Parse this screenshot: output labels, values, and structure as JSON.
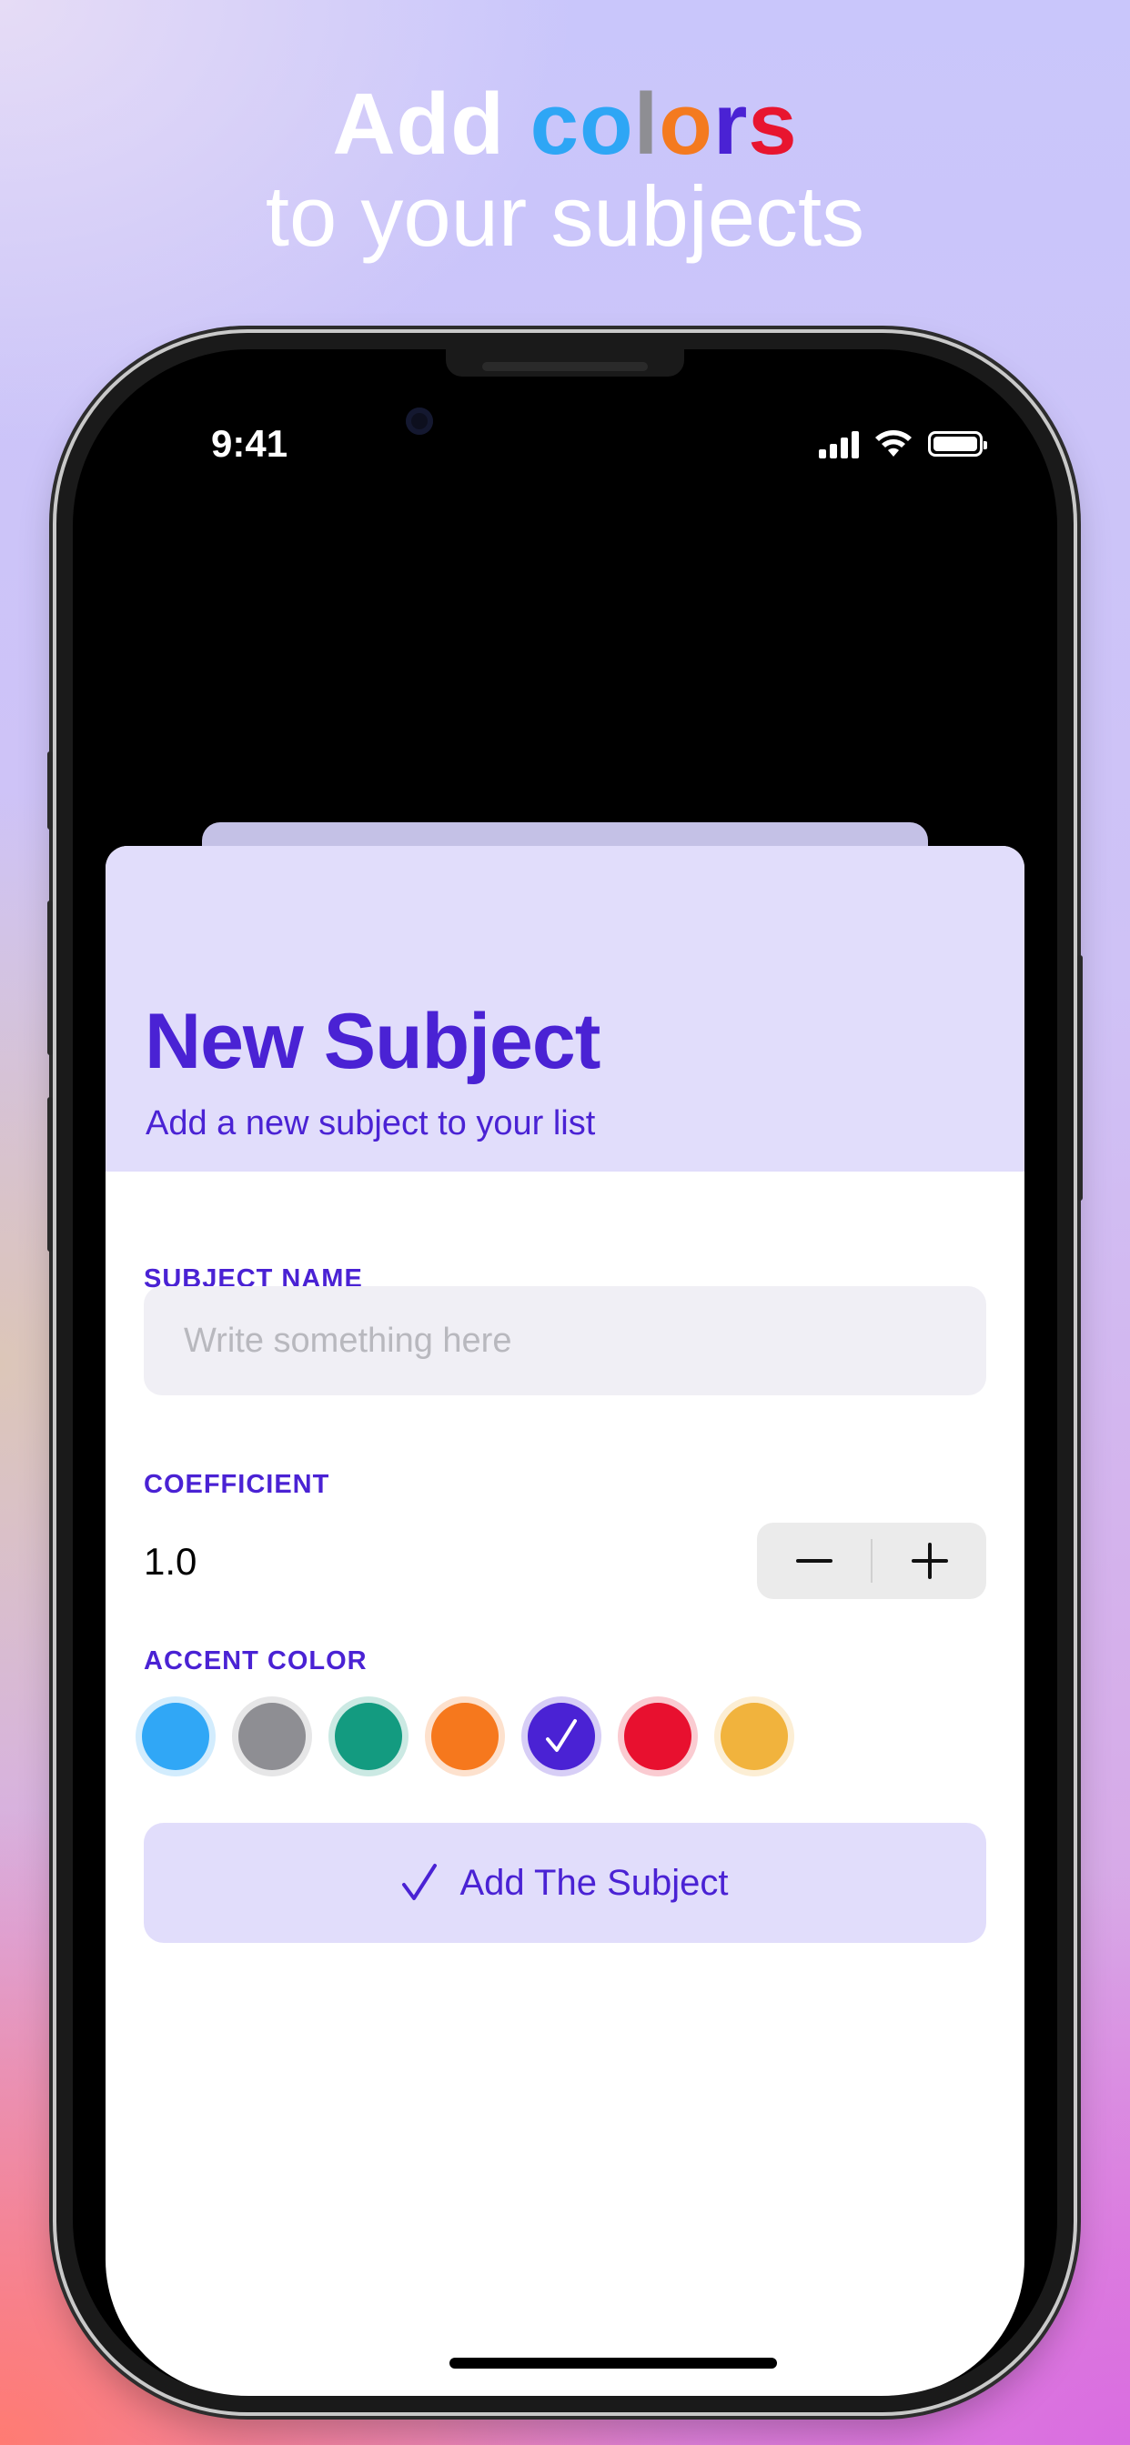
{
  "headline": {
    "line1_prefix": "Add",
    "line1_colored": [
      {
        "char": "c",
        "color": "#2ea6f5"
      },
      {
        "char": "o",
        "color": "#2ea6f5"
      },
      {
        "char": "l",
        "color": "#8e8e93"
      },
      {
        "char": "o",
        "color": "#f47a1f"
      },
      {
        "char": "r",
        "color": "#4a22d4"
      },
      {
        "char": "s",
        "color": "#e8152f"
      }
    ],
    "line2": "to your subjects"
  },
  "status_bar": {
    "time": "9:41"
  },
  "sheet": {
    "title": "New Subject",
    "subtitle": "Add a new subject to your list"
  },
  "form": {
    "subject_name_label": "SUBJECT NAME",
    "subject_name_value": "",
    "subject_name_placeholder": "Write something here",
    "coefficient_label": "COEFFICIENT",
    "coefficient_value": "1.0",
    "accent_color_label": "ACCENT COLOR",
    "colors": [
      {
        "name": "blue",
        "hex": "#30a7f6",
        "selected": false
      },
      {
        "name": "gray",
        "hex": "#8e8e93",
        "selected": false
      },
      {
        "name": "teal",
        "hex": "#139b80",
        "selected": false
      },
      {
        "name": "orange",
        "hex": "#f6781d",
        "selected": false
      },
      {
        "name": "indigo",
        "hex": "#4a22d4",
        "selected": true
      },
      {
        "name": "red",
        "hex": "#e8102f",
        "selected": false
      },
      {
        "name": "yellow",
        "hex": "#f1b33d",
        "selected": false
      }
    ],
    "add_button_label": "Add The Subject"
  },
  "theme": {
    "accent": "#4a22d4",
    "header_bg": "#e1ddfb"
  }
}
